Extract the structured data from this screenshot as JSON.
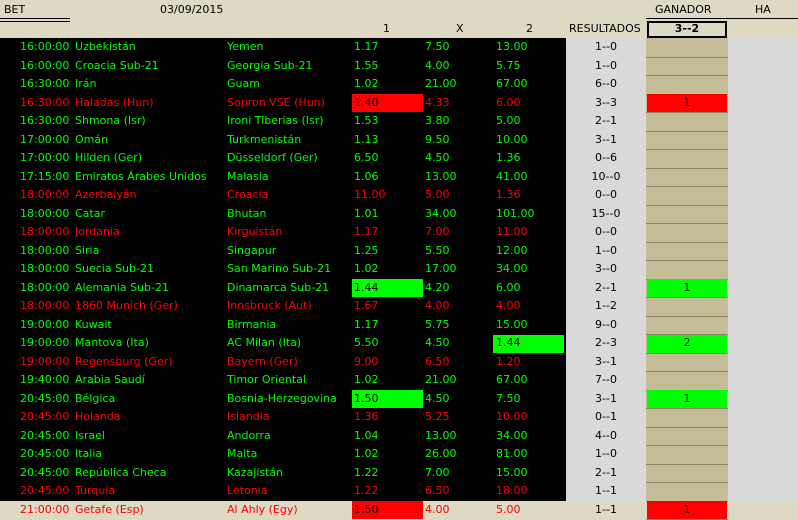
{
  "header": {
    "bet": "BET",
    "date": "03/09/2015",
    "ganador": "GANADOR",
    "ha": "HA",
    "col1": "1",
    "colx": "X",
    "col2": "2",
    "resultados": "RESULTADOS",
    "score": "3--2"
  },
  "colors": {
    "green_text": "#00ff00",
    "red_text": "#ff0000",
    "red_fill": "#ff0000",
    "green_fill": "#00ff00",
    "ganador_bg": "#c4bd97",
    "result_bg": "#d9d9d9"
  },
  "rows": [
    {
      "time": "16:00:00",
      "home": "Uzbekistán",
      "away": "Yemen",
      "o1": "1.17",
      "ox": "7.50",
      "o2": "13.00",
      "res": "1--0",
      "win": "",
      "color": "g",
      "hl": ""
    },
    {
      "time": "16:00:00",
      "home": "Croacia Sub-21",
      "away": "Georgia Sub-21",
      "o1": "1.55",
      "ox": "4.00",
      "o2": "5.75",
      "res": "1--0",
      "win": "",
      "color": "g",
      "hl": ""
    },
    {
      "time": "16:30:00",
      "home": "Irán",
      "away": "Guam",
      "o1": "1.02",
      "ox": "21.00",
      "o2": "67.00",
      "res": "6--0",
      "win": "",
      "color": "g",
      "hl": ""
    },
    {
      "time": "16:30:00",
      "home": "Haladas (Hun)",
      "away": "Sopron VSE (Hun)",
      "o1": "1.40",
      "ox": "4.33",
      "o2": "6.00",
      "res": "3--3",
      "win": "1",
      "color": "r",
      "hl": "o1r"
    },
    {
      "time": "16:30:00",
      "home": "Shmona (Isr)",
      "away": "Ironi Tiberias (Isr)",
      "o1": "1.53",
      "ox": "3.80",
      "o2": "5.00",
      "res": "2--1",
      "win": "",
      "color": "g",
      "hl": ""
    },
    {
      "time": "17:00:00",
      "home": "Omán",
      "away": "Turkmenistán",
      "o1": "1.13",
      "ox": "9.50",
      "o2": "10.00",
      "res": "3--1",
      "win": "",
      "color": "g",
      "hl": ""
    },
    {
      "time": "17:00:00",
      "home": "Hilden (Ger)",
      "away": "Düsseldorf (Ger)",
      "o1": "6.50",
      "ox": "4.50",
      "o2": "1.36",
      "res": "0--6",
      "win": "",
      "color": "g",
      "hl": ""
    },
    {
      "time": "17:15:00",
      "home": "Emiratos Árabes Unidos",
      "away": "Malasia",
      "o1": "1.06",
      "ox": "13.00",
      "o2": "41.00",
      "res": "10--0",
      "win": "",
      "color": "g",
      "hl": ""
    },
    {
      "time": "18:00:00",
      "home": "Azerbaiyán",
      "away": "Croacia",
      "o1": "11.00",
      "ox": "5.00",
      "o2": "1.36",
      "res": "0--0",
      "win": "",
      "color": "r",
      "hl": ""
    },
    {
      "time": "18:00:00",
      "home": "Catar",
      "away": "Bhutan",
      "o1": "1.01",
      "ox": "34.00",
      "o2": "101.00",
      "res": "15--0",
      "win": "",
      "color": "g",
      "hl": ""
    },
    {
      "time": "18:00:00",
      "home": "Jordania",
      "away": "Kirguistán",
      "o1": "1.17",
      "ox": "7.00",
      "o2": "11.00",
      "res": "0--0",
      "win": "",
      "color": "r",
      "hl": ""
    },
    {
      "time": "18:00:00",
      "home": "Siria",
      "away": "Singapur",
      "o1": "1.25",
      "ox": "5.50",
      "o2": "12.00",
      "res": "1--0",
      "win": "",
      "color": "g",
      "hl": ""
    },
    {
      "time": "18:00:00",
      "home": "Suecia Sub-21",
      "away": "San Marino Sub-21",
      "o1": "1.02",
      "ox": "17.00",
      "o2": "34.00",
      "res": "3--0",
      "win": "",
      "color": "g",
      "hl": ""
    },
    {
      "time": "18:00:00",
      "home": "Alemania Sub-21",
      "away": "Dinamarca Sub-21",
      "o1": "1.44",
      "ox": "4.20",
      "o2": "6.00",
      "res": "2--1",
      "win": "1",
      "color": "g",
      "hl": "o1g"
    },
    {
      "time": "18:00:00",
      "home": "1860 Munich (Ger)",
      "away": "Innsbruck (Aut)",
      "o1": "1.67",
      "ox": "4.00",
      "o2": "4.00",
      "res": "1--2",
      "win": "",
      "color": "r",
      "hl": ""
    },
    {
      "time": "19:00:00",
      "home": "Kuwait",
      "away": "Birmania",
      "o1": "1.17",
      "ox": "5.75",
      "o2": "15.00",
      "res": "9--0",
      "win": "",
      "color": "g",
      "hl": ""
    },
    {
      "time": "19:00:00",
      "home": "Mantova (Ita)",
      "away": "AC Milan (Ita)",
      "o1": "5.50",
      "ox": "4.50",
      "o2": "1.44",
      "res": "2--3",
      "win": "2",
      "color": "g",
      "hl": "o2g"
    },
    {
      "time": "19:00:00",
      "home": "Regensburg (Ger)",
      "away": "Bayern (Ger)",
      "o1": "9.00",
      "ox": "6.50",
      "o2": "1.20",
      "res": "3--1",
      "win": "",
      "color": "r",
      "hl": ""
    },
    {
      "time": "19:40:00",
      "home": "Arabia Saudí",
      "away": "Timor Oriental",
      "o1": "1.02",
      "ox": "21.00",
      "o2": "67.00",
      "res": "7--0",
      "win": "",
      "color": "g",
      "hl": ""
    },
    {
      "time": "20:45:00",
      "home": "Bélgica",
      "away": "Bosnia-Herzegovina",
      "o1": "1.50",
      "ox": "4.50",
      "o2": "7.50",
      "res": "3--1",
      "win": "1",
      "color": "g",
      "hl": "o1g"
    },
    {
      "time": "20:45:00",
      "home": "Holanda",
      "away": "Islandia",
      "o1": "1.36",
      "ox": "5.25",
      "o2": "10.00",
      "res": "0--1",
      "win": "",
      "color": "r",
      "hl": ""
    },
    {
      "time": "20:45:00",
      "home": "Israel",
      "away": "Andorra",
      "o1": "1.04",
      "ox": "13.00",
      "o2": "34.00",
      "res": "4--0",
      "win": "",
      "color": "g",
      "hl": ""
    },
    {
      "time": "20:45:00",
      "home": "Italia",
      "away": "Malta",
      "o1": "1.02",
      "ox": "26.00",
      "o2": "81.00",
      "res": "1--0",
      "win": "",
      "color": "g",
      "hl": ""
    },
    {
      "time": "20:45:00",
      "home": "República Checa",
      "away": "Kazajistán",
      "o1": "1.22",
      "ox": "7.00",
      "o2": "15.00",
      "res": "2--1",
      "win": "",
      "color": "g",
      "hl": ""
    },
    {
      "time": "20:45:00",
      "home": "Turquía",
      "away": "Letonia",
      "o1": "1.22",
      "ox": "6.50",
      "o2": "18.00",
      "res": "1--1",
      "win": "",
      "color": "r",
      "hl": ""
    },
    {
      "time": "21:00:00",
      "home": "Getafe (Esp)",
      "away": "Al Ahly (Egy)",
      "o1": "1.50",
      "ox": "4.00",
      "o2": "5.00",
      "res": "1--1",
      "win": "1",
      "color": "r",
      "hl": "o1r"
    }
  ]
}
